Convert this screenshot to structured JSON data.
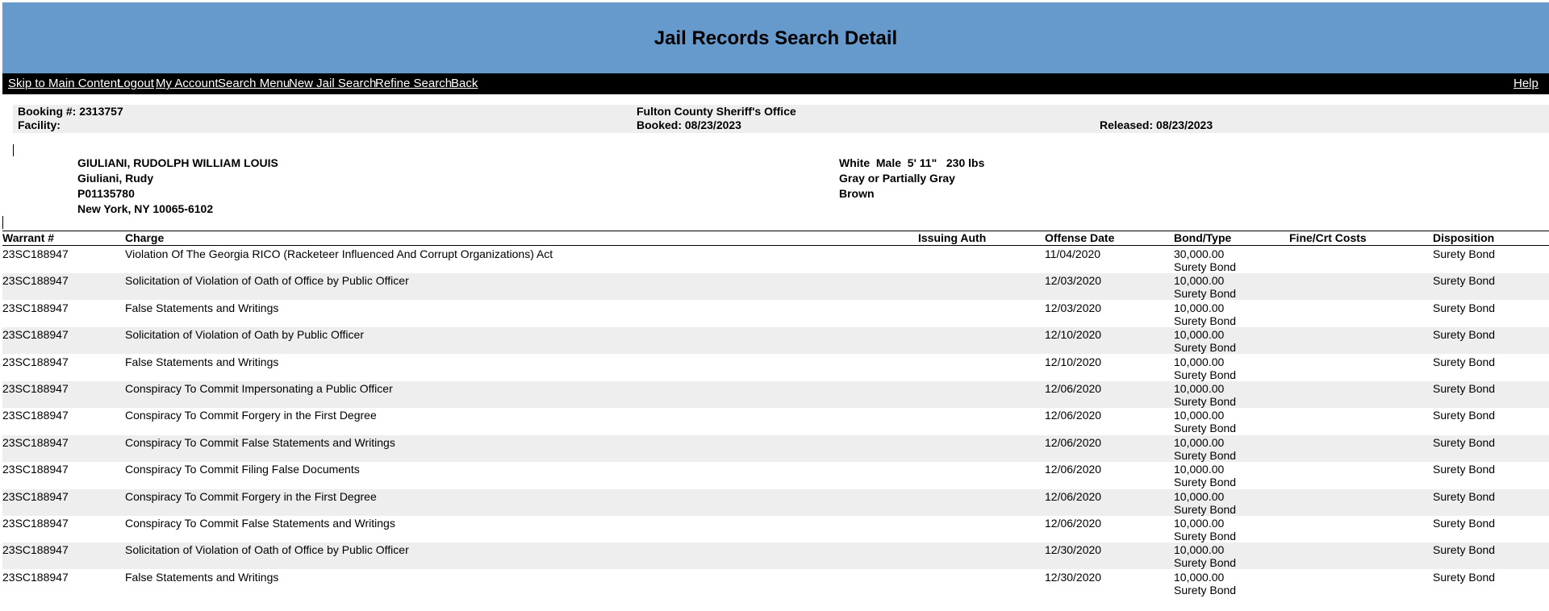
{
  "header": {
    "title": "Jail Records Search Detail"
  },
  "nav": {
    "links": [
      "Skip to Main Content",
      "Logout",
      "My Account",
      "Search Menu",
      "New Jail Search",
      "Refine Search",
      "Back"
    ],
    "help": "Help"
  },
  "booking": {
    "booking_no": "Booking #: 2313757",
    "facility": "Facility:",
    "agency": "Fulton County Sheriff's Office",
    "booked": "Booked: 08/23/2023",
    "released": "Released: 08/23/2023"
  },
  "person": {
    "name": "GIULIANI, RUDOLPH WILLIAM LOUIS",
    "alias": "Giuliani, Rudy",
    "id": "P01135780",
    "location": "New York, NY 10065-6102",
    "physical": "White  Male  5' 11\"   230 lbs",
    "hair": "Gray or Partially Gray",
    "eyes": "Brown"
  },
  "table": {
    "columns": [
      "Warrant #",
      "Charge",
      "Issuing Auth",
      "Offense Date",
      "Bond/Type",
      "Fine/Crt Costs",
      "Disposition"
    ],
    "rows": [
      {
        "warrant": "23SC188947",
        "charge": "Violation Of The Georgia RICO (Racketeer Influenced And Corrupt Organizations) Act",
        "date": "11/04/2020",
        "bond": "30,000.00",
        "bond_type": "Surety Bond",
        "disposition": "Surety Bond"
      },
      {
        "warrant": "23SC188947",
        "charge": "Solicitation of Violation of Oath of Office by Public Officer",
        "date": "12/03/2020",
        "bond": "10,000.00",
        "bond_type": "Surety Bond",
        "disposition": "Surety Bond"
      },
      {
        "warrant": "23SC188947",
        "charge": "False Statements and Writings",
        "date": "12/03/2020",
        "bond": "10,000.00",
        "bond_type": "Surety Bond",
        "disposition": "Surety Bond"
      },
      {
        "warrant": "23SC188947",
        "charge": "Solicitation of Violation of Oath by Public Officer",
        "date": "12/10/2020",
        "bond": "10,000.00",
        "bond_type": "Surety Bond",
        "disposition": "Surety Bond"
      },
      {
        "warrant": "23SC188947",
        "charge": "False Statements and Writings",
        "date": "12/10/2020",
        "bond": "10,000.00",
        "bond_type": "Surety Bond",
        "disposition": "Surety Bond"
      },
      {
        "warrant": "23SC188947",
        "charge": "Conspiracy To Commit Impersonating a Public Officer",
        "date": "12/06/2020",
        "bond": "10,000.00",
        "bond_type": "Surety Bond",
        "disposition": "Surety Bond"
      },
      {
        "warrant": "23SC188947",
        "charge": "Conspiracy To Commit Forgery in the First Degree",
        "date": "12/06/2020",
        "bond": "10,000.00",
        "bond_type": "Surety Bond",
        "disposition": "Surety Bond"
      },
      {
        "warrant": "23SC188947",
        "charge": "Conspiracy To Commit False Statements and Writings",
        "date": "12/06/2020",
        "bond": "10,000.00",
        "bond_type": "Surety Bond",
        "disposition": "Surety Bond"
      },
      {
        "warrant": "23SC188947",
        "charge": "Conspiracy To Commit Filing False Documents",
        "date": "12/06/2020",
        "bond": "10,000.00",
        "bond_type": "Surety Bond",
        "disposition": "Surety Bond"
      },
      {
        "warrant": "23SC188947",
        "charge": "Conspiracy To Commit Forgery in the First Degree",
        "date": "12/06/2020",
        "bond": "10,000.00",
        "bond_type": "Surety Bond",
        "disposition": "Surety Bond"
      },
      {
        "warrant": "23SC188947",
        "charge": "Conspiracy To Commit False Statements and Writings",
        "date": "12/06/2020",
        "bond": "10,000.00",
        "bond_type": "Surety Bond",
        "disposition": "Surety Bond"
      },
      {
        "warrant": "23SC188947",
        "charge": "Solicitation of Violation of Oath of Office by Public Officer",
        "date": "12/30/2020",
        "bond": "10,000.00",
        "bond_type": "Surety Bond",
        "disposition": "Surety Bond"
      },
      {
        "warrant": "23SC188947",
        "charge": "False Statements and Writings",
        "date": "12/30/2020",
        "bond": "10,000.00",
        "bond_type": "Surety Bond",
        "disposition": "Surety Bond"
      }
    ]
  },
  "colors": {
    "header_bg": "#6699cc",
    "nav_bg": "#000000",
    "stripe": "#eeeeee"
  }
}
